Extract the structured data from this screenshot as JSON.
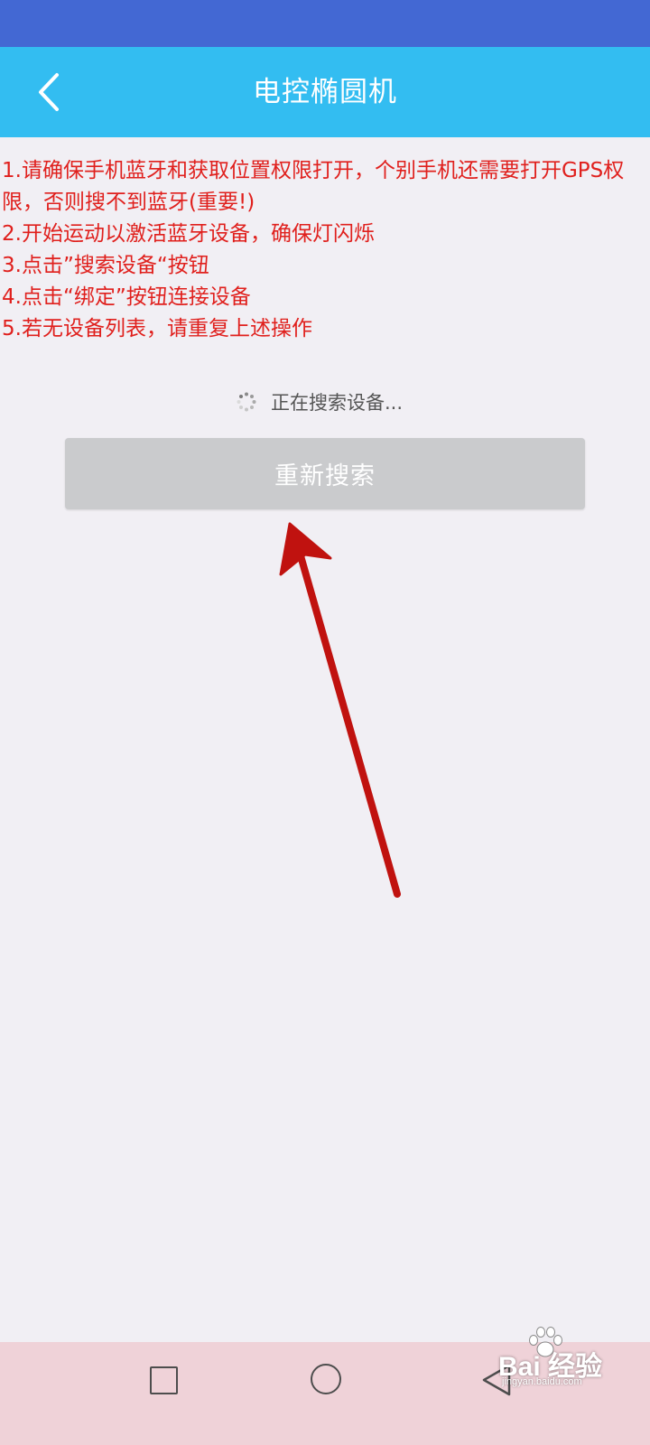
{
  "app_bar": {
    "title": "电控椭圆机",
    "back_icon": "chevron-left-icon"
  },
  "instructions": [
    "1.请确保手机蓝牙和获取位置权限打开，个别手机还需要打开GPS权限，否则搜不到蓝牙(重要!)",
    "2.开始运动以激活蓝牙设备，确保灯闪烁",
    "3.点击”搜索设备“按钮",
    "4.点击“绑定”按钮连接设备",
    "5.若无设备列表，请重复上述操作"
  ],
  "search": {
    "status_text": "正在搜索设备...",
    "button_label": "重新搜索"
  },
  "nav_bar": {
    "recents_icon": "square-icon",
    "home_icon": "circle-icon",
    "back_icon": "triangle-back-icon"
  },
  "watermark": {
    "brand": "Bai 经验",
    "url": "jingyan.baidu.com"
  },
  "colors": {
    "status_bar": "#4368d3",
    "app_bar": "#33bdf1",
    "instruction_text": "#e0201d",
    "button_bg": "#cacbcd",
    "background": "#f1eff4",
    "nav_bar": "#efd2d8",
    "annotation_arrow": "#c0120f"
  }
}
